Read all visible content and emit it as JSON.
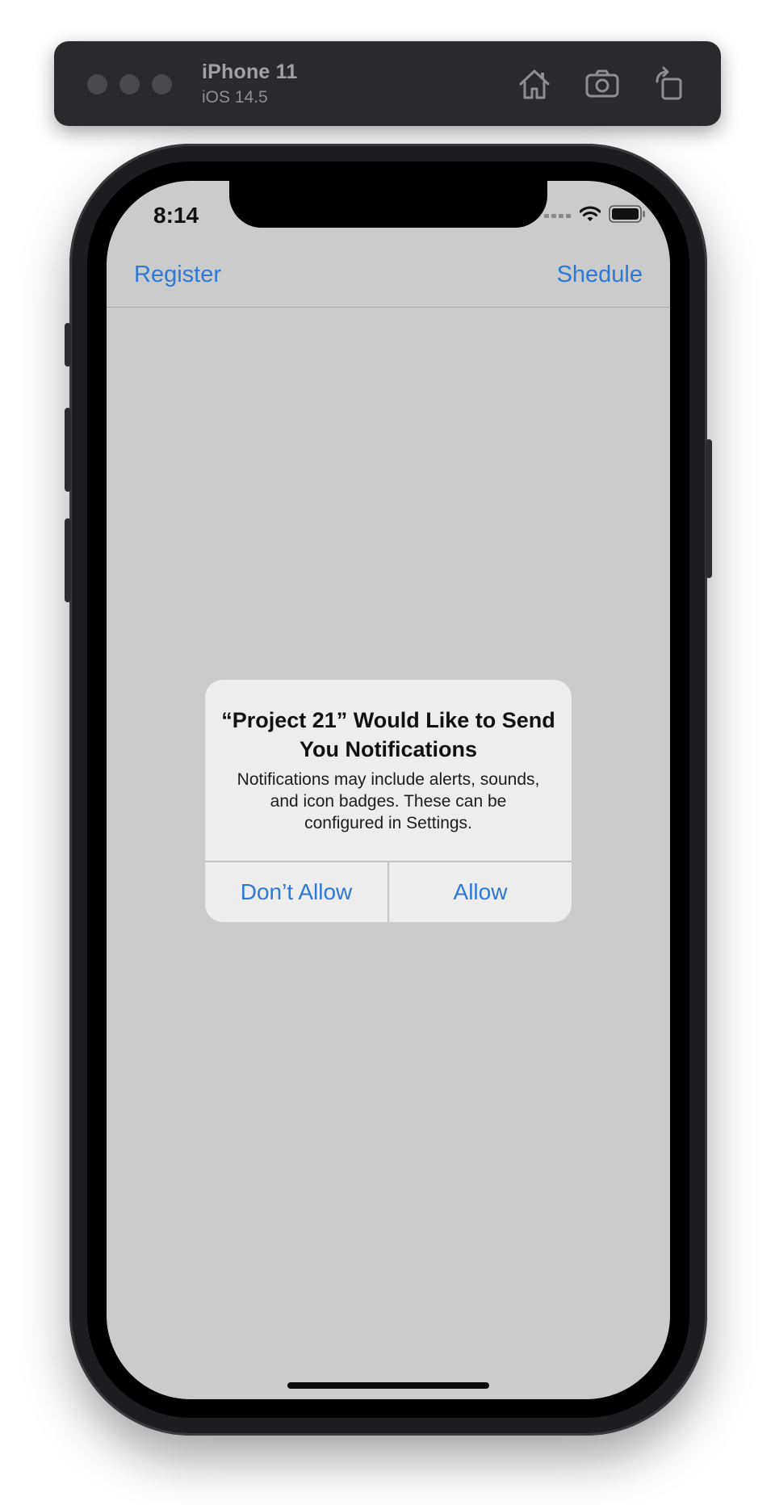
{
  "simulator": {
    "device_name": "iPhone 11",
    "os_version": "iOS 14.5",
    "toolbar_icons": [
      "home-icon",
      "screenshot-camera-icon",
      "rotate-icon"
    ]
  },
  "status_bar": {
    "time": "8:14",
    "icons": [
      "cellular-signal-icon",
      "wifi-icon",
      "battery-icon"
    ]
  },
  "nav_bar": {
    "left_button": "Register",
    "right_button": "Shedule"
  },
  "alert": {
    "title": "“Project 21” Would Like to Send You Notifications",
    "message": "Notifications may include alerts, sounds, and icon badges. These can be configured in Settings.",
    "buttons": [
      "Don’t Allow",
      "Allow"
    ]
  },
  "colors": {
    "accent": "#2e78d6",
    "screen_background": "#cbcbcb",
    "alert_background": "#ededed",
    "toolbar_background": "#2a2a2c"
  }
}
